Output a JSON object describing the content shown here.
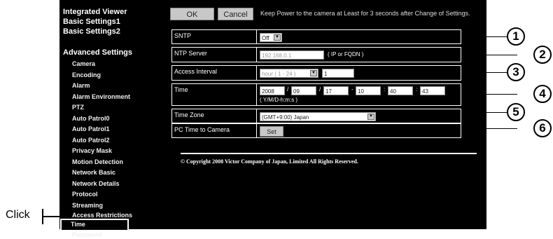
{
  "sidebar": {
    "top_items": [
      "Integrated Viewer",
      "Basic Settings1",
      "Basic Settings2"
    ],
    "section_heading": "Advanced Settings",
    "items": [
      "Camera",
      "Encoding",
      "Alarm",
      "Alarm Environment",
      "PTZ",
      "Auto Patrol0",
      "Auto Patrol1",
      "Auto Patrol2",
      "Privacy Mask",
      "Motion Detection",
      "Network Basic",
      "Network Details",
      "Protocol",
      "Streaming",
      "Access Restrictions",
      "Time",
      "Password"
    ],
    "selected": "Time"
  },
  "annotation": {
    "click_label": "Click"
  },
  "toolbar": {
    "ok_label": "OK",
    "cancel_label": "Cancel",
    "notice": "Keep Power to the camera at Least for 3 seconds after Change of Settings."
  },
  "form": {
    "sntp": {
      "label": "SNTP",
      "value": "Off",
      "callout": "1"
    },
    "ntp_server": {
      "label": "NTP Server",
      "value": "192.168.0.1",
      "hint": "( IP or FQDN )",
      "callout": "2"
    },
    "access_interval": {
      "label": "Access Interval",
      "unit_value": "hour ( 1 - 24 )",
      "value": "1",
      "callout": "3"
    },
    "time": {
      "label": "Time",
      "year": "2008",
      "month": "09",
      "day": "17",
      "hour": "10",
      "minute": "40",
      "second": "43",
      "sep_slash": "/",
      "sep_dash": "-",
      "sep_colon": ":",
      "format_hint": "( Y/M/D-h:m:s )",
      "callout": "4"
    },
    "time_zone": {
      "label": "Time Zone",
      "value": "(GMT+9:00) Japan",
      "callout": "5"
    },
    "pc_time": {
      "label": "PC Time to Camera",
      "button": "Set",
      "callout": "6"
    }
  },
  "footer": {
    "copyright": "© Copyright 2008 Victor Company of Japan, Limited All Rights Reserved."
  },
  "icons": {
    "dropdown": "dropdown-arrow-icon",
    "callout": "circled-number-icon"
  },
  "colors": {
    "background": "#000000",
    "text": "#ffffff",
    "button": "#c8c8c8"
  }
}
